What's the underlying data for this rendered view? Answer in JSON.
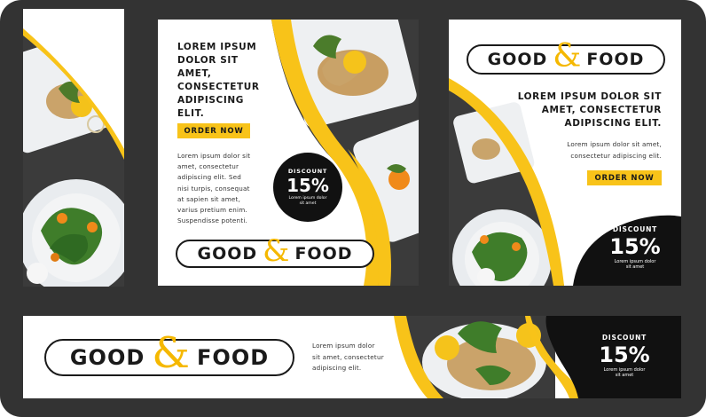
{
  "brand": {
    "word1": "GOOD",
    "amp": "&",
    "word2": "FOOD",
    "accent": "#f8c319",
    "dark": "#111111"
  },
  "square_banner_1": {
    "headline": [
      "LOREM IPSUM",
      "DOLOR SIT",
      "AMET,",
      "CONSECTETUR",
      "ADIPISCING",
      "ELIT."
    ],
    "button": "ORDER NOW",
    "body": [
      "Lorem ipsum dolor sit",
      "amet, consectetur",
      "adipiscing elit. Sed",
      "nisi turpis, consequat",
      "at sapien sit amet,",
      "varius pretium enim.",
      "Suspendisse potenti."
    ],
    "discount_label": "DISCOUNT",
    "discount_value": "15%",
    "discount_sub": [
      "Lorem ipsum dolor",
      "sit amet"
    ]
  },
  "square_banner_2": {
    "headline": [
      "LOREM IPSUM DOLOR SIT",
      "AMET, CONSECTETUR",
      "ADIPISCING ELIT."
    ],
    "body": [
      "Lorem ipsum dolor sit amet,",
      "consectetur adipiscing elit."
    ],
    "button": "ORDER NOW",
    "discount_label": "DISCOUNT",
    "discount_value": "15%",
    "discount_sub": [
      "Lorem ipsum dolor",
      "sit amet"
    ]
  },
  "leaderboard_banner": {
    "body": [
      "Lorem ipsum dolor",
      "sit amet, consectetur",
      "adipiscing elit."
    ],
    "discount_label": "DISCOUNT",
    "discount_value": "15%",
    "discount_sub": [
      "Lorem ipsum dolor",
      "sit amet"
    ]
  }
}
